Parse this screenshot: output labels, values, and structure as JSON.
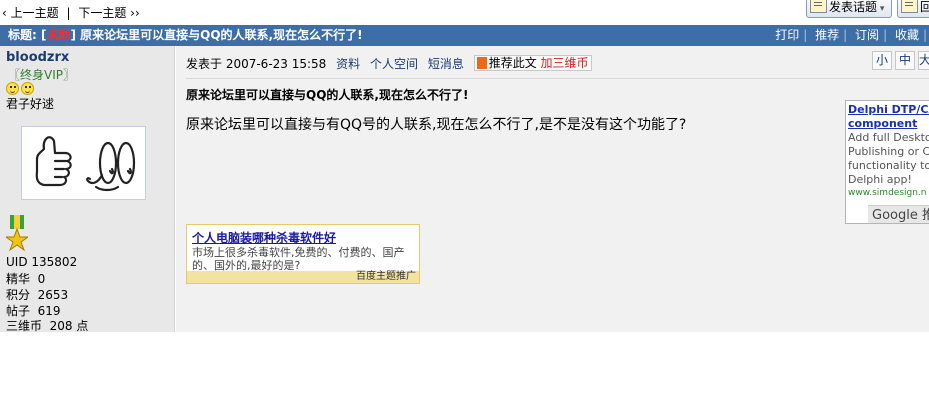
{
  "nav": {
    "prev_topic": "‹ 上一主题",
    "separator": "|",
    "next_topic": "下一主题 ››",
    "new_topic_button": "发表话题",
    "reply_button": "回"
  },
  "thread": {
    "title_prefix": "标题: [",
    "tag": "求助",
    "title_suffix": "] 原来论坛里可以直接与QQ的人联系,现在怎么不行了!",
    "actions": [
      "打印",
      "推荐",
      "订阅",
      "收藏"
    ]
  },
  "author": {
    "username": "bloodzrx",
    "group": "〖终身VIP〗",
    "motto": "君子好逑",
    "stats": [
      {
        "label": "UID",
        "value": "135802"
      },
      {
        "label": "精华",
        "value": "0"
      },
      {
        "label": "积分",
        "value": "2653"
      },
      {
        "label": "帖子",
        "value": "619"
      },
      {
        "label": "三维币",
        "value": "208 点"
      }
    ]
  },
  "post": {
    "posted_label": "发表于 2007-6-23 15:58",
    "links": [
      "资料",
      "个人空间",
      "短消息"
    ],
    "recommend": "推荐此文",
    "add_coins": "加三维币",
    "font_sizes": [
      "小",
      "中",
      "大"
    ],
    "title": "原来论坛里可以直接与QQ的人联系,现在怎么不行了!",
    "body": "原来论坛里可以直接与有QQ号的人联系,现在怎么不行了,是不是没有这个功能了?"
  },
  "google_ad": {
    "title_line1": "Delphi DTP/CAD",
    "title_line2": "component",
    "desc": [
      "Add full Desktop",
      "Publishing or CAD",
      "functionality to yo",
      "Delphi app!"
    ],
    "url": "www.simdesign.n",
    "brand": "Google 推"
  },
  "baidu_ad": {
    "title": "个人电脑装哪种杀毒软件好",
    "desc": "市场上很多杀毒软件,免费的、付费的、国产的、国外的,最好的是?",
    "footer": "百度主题推广"
  },
  "colors": {
    "titlebar": "#3d6ea7",
    "tag": "#ff2a2a",
    "left_bg": "#e8e8e8",
    "main_bg": "#f1f1f1"
  }
}
